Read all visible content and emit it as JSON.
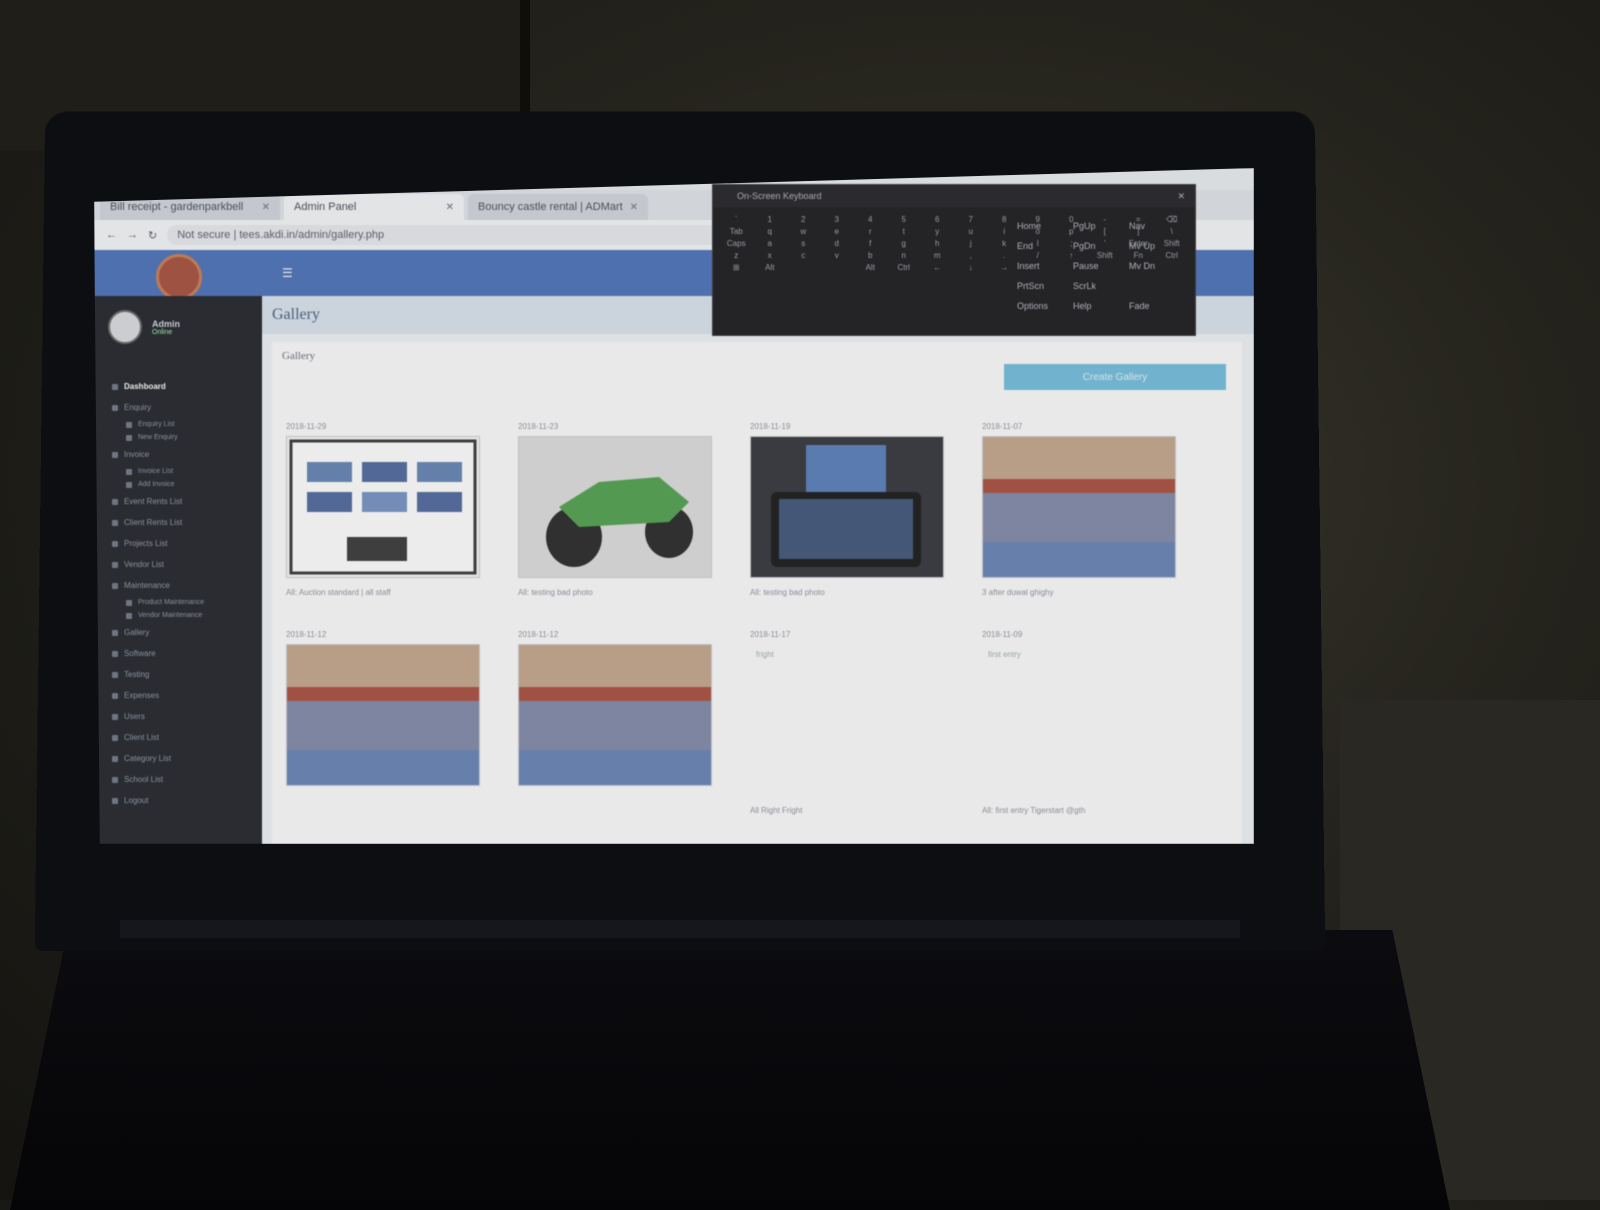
{
  "browser": {
    "tabs": [
      {
        "label": "Bill receipt - gardenparkbell"
      },
      {
        "label": "Admin Panel"
      },
      {
        "label": "Bouncy castle rental | ADMart"
      }
    ],
    "address": "Not secure | tees.akdi.in/admin/gallery.php"
  },
  "app": {
    "user": {
      "name": "Admin",
      "status": "Online"
    },
    "nav": [
      {
        "label": "Dashboard",
        "type": "item",
        "active": true
      },
      {
        "label": "Enquiry",
        "type": "item"
      },
      {
        "label": "Enquiry List",
        "type": "sub"
      },
      {
        "label": "New Enquiry",
        "type": "sub"
      },
      {
        "label": "Invoice",
        "type": "item"
      },
      {
        "label": "Invoice List",
        "type": "sub"
      },
      {
        "label": "Add Invoice",
        "type": "sub"
      },
      {
        "label": "Event Rents List",
        "type": "item"
      },
      {
        "label": "Client Rents List",
        "type": "item"
      },
      {
        "label": "Projects List",
        "type": "item"
      },
      {
        "label": "Vendor List",
        "type": "item"
      },
      {
        "label": "Maintenance",
        "type": "item"
      },
      {
        "label": "Product Maintenance",
        "type": "sub"
      },
      {
        "label": "Vendor Maintenance",
        "type": "sub"
      },
      {
        "label": "Gallery",
        "type": "item"
      },
      {
        "label": "Software",
        "type": "item"
      },
      {
        "label": "Testing",
        "type": "item"
      },
      {
        "label": "Expenses",
        "type": "item"
      },
      {
        "label": "Users",
        "type": "item"
      },
      {
        "label": "Client List",
        "type": "item"
      },
      {
        "label": "Category List",
        "type": "item"
      },
      {
        "label": "School List",
        "type": "item"
      },
      {
        "label": "Logout",
        "type": "item"
      }
    ],
    "page_title": "Gallery",
    "panel_title": "Gallery",
    "create_button": "Create Gallery",
    "gallery": [
      {
        "date": "2018-11-29",
        "caption": "All: Auction standard | all staff",
        "kind": "flyer"
      },
      {
        "date": "2018-11-23",
        "caption": "All: testing bad photo",
        "kind": "atv"
      },
      {
        "date": "2018-11-19",
        "caption": "All: testing bad photo",
        "kind": "tablet"
      },
      {
        "date": "2018-11-07",
        "caption": "3 after duwal ghighy",
        "kind": "bouncy"
      },
      {
        "date": "2018-11-12",
        "caption": "",
        "kind": "bouncy"
      },
      {
        "date": "2018-11-12",
        "caption": "",
        "kind": "bouncy"
      },
      {
        "date": "2018-11-17",
        "caption": "All Right Fright",
        "kind": "broken",
        "alt": "fright"
      },
      {
        "date": "2018-11-09",
        "caption": "All: first entry Tigerstart @gth",
        "kind": "broken",
        "alt": "first entry"
      }
    ]
  },
  "osk": {
    "title": "On-Screen Keyboard",
    "rows": [
      "` 1 2 3 4 5 6 7 8 9 0 - = ⌫",
      "Tab q w e r t y u i o p [ ] \\",
      "Caps a s d f g h j k l ; ' Enter",
      "Shift z x c v b n m , . / ↑ Shift",
      "Fn Ctrl ⊞ Alt   Alt Ctrl ← ↓ →"
    ],
    "side": [
      "Home",
      "PgUp",
      "Nav",
      "End",
      "PgDn",
      "Mv Up",
      "Insert",
      "Pause",
      "Mv Dn",
      "PrtScn",
      "ScrLk",
      "",
      "Options",
      "Help",
      "Fade"
    ]
  }
}
